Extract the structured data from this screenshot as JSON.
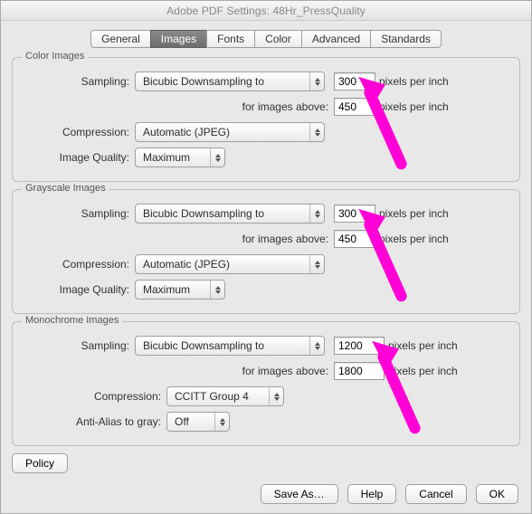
{
  "window_title": "Adobe PDF Settings: 48Hr_PressQuality",
  "tabs": [
    "General",
    "Images",
    "Fonts",
    "Color",
    "Advanced",
    "Standards"
  ],
  "active_tab_index": 1,
  "color": {
    "group_label": "Color Images",
    "sampling_label": "Sampling:",
    "sampling_value": "Bicubic Downsampling to",
    "ppi": "300",
    "ppi_suffix": "pixels per inch",
    "above_label": "for images above:",
    "above_value": "450",
    "above_suffix": "pixels per inch",
    "compression_label": "Compression:",
    "compression_value": "Automatic (JPEG)",
    "quality_label": "Image Quality:",
    "quality_value": "Maximum"
  },
  "gray": {
    "group_label": "Grayscale Images",
    "sampling_label": "Sampling:",
    "sampling_value": "Bicubic Downsampling to",
    "ppi": "300",
    "ppi_suffix": "pixels per inch",
    "above_label": "for images above:",
    "above_value": "450",
    "above_suffix": "pixels per inch",
    "compression_label": "Compression:",
    "compression_value": "Automatic (JPEG)",
    "quality_label": "Image Quality:",
    "quality_value": "Maximum"
  },
  "mono": {
    "group_label": "Monochrome Images",
    "sampling_label": "Sampling:",
    "sampling_value": "Bicubic Downsampling to",
    "ppi": "1200",
    "ppi_suffix": "pixels per inch",
    "above_label": "for images above:",
    "above_value": "1800",
    "above_suffix": "pixels per inch",
    "compression_label": "Compression:",
    "compression_value": "CCITT Group 4",
    "aa_label": "Anti-Alias to gray:",
    "aa_value": "Off"
  },
  "policy_button": "Policy",
  "footer": {
    "save_as": "Save As…",
    "help": "Help",
    "cancel": "Cancel",
    "ok": "OK"
  }
}
